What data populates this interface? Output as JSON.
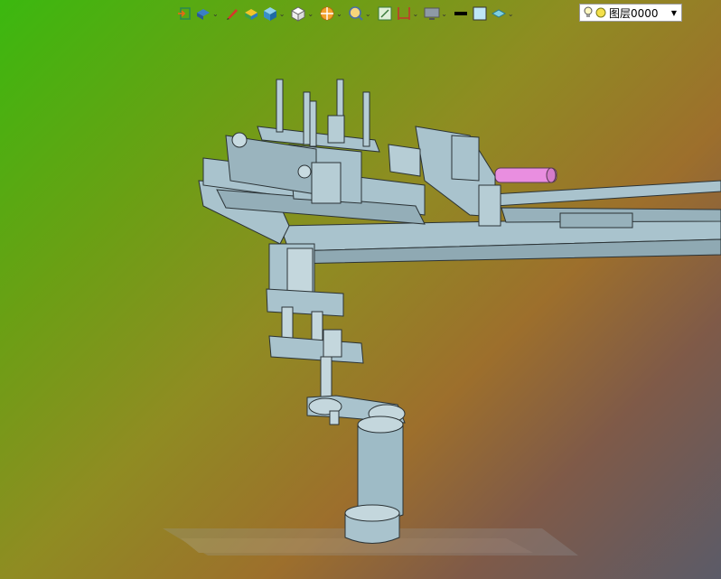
{
  "toolbar": {
    "tools": [
      {
        "icon": "exit-sketch-icon",
        "has_dropdown": false
      },
      {
        "icon": "view-orient-icon",
        "has_dropdown": true
      },
      {
        "icon": "sketch-pen-icon",
        "has_dropdown": false
      },
      {
        "icon": "shaded-box-icon",
        "has_dropdown": false
      },
      {
        "icon": "display-style-icon",
        "has_dropdown": true
      },
      {
        "icon": "hide-show-icon",
        "has_dropdown": true
      },
      {
        "icon": "section-view-icon",
        "has_dropdown": true
      },
      {
        "icon": "zoom-icon",
        "has_dropdown": true
      },
      {
        "icon": "grid-snap-icon",
        "has_dropdown": false
      },
      {
        "icon": "dimension-icon",
        "has_dropdown": true
      },
      {
        "icon": "monitor-view-icon",
        "has_dropdown": true
      },
      {
        "icon": "line-color-icon",
        "has_dropdown": false
      },
      {
        "icon": "fill-color-icon",
        "has_dropdown": false
      },
      {
        "icon": "layer-stack-icon",
        "has_dropdown": true
      }
    ],
    "layer_selector": {
      "value": "图层0000"
    }
  },
  "colors": {
    "part_fill": "#a9c3cd",
    "part_stroke": "#2b3336",
    "highlight_part": "#e98ee0"
  }
}
